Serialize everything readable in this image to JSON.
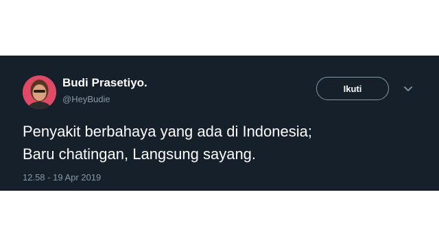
{
  "tweet": {
    "author": {
      "display_name": "Budi Prasetiyo.",
      "handle": "@HeyBudie"
    },
    "follow_label": "Ikuti",
    "text_lines": [
      "Penyakit berbahaya yang ada di Indonesia;",
      "Baru chatingan, Langsung sayang."
    ],
    "timestamp": "12.58 - 19 Apr 2019"
  },
  "colors": {
    "card_background": "#15202b",
    "secondary_text": "#8899a6",
    "primary_text": "#ffffff"
  },
  "icons": {
    "menu": "chevron-down-icon",
    "avatar": "profile-photo"
  }
}
